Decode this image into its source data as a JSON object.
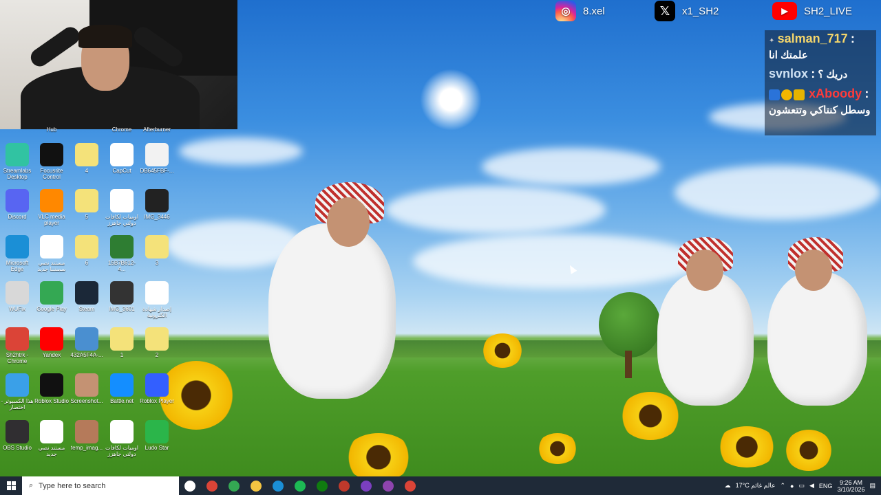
{
  "overlay": {
    "socials": [
      {
        "icon": "instagram-icon",
        "handle": "8.xel"
      },
      {
        "icon": "x-icon",
        "handle": "x1_SH2"
      },
      {
        "icon": "youtube-icon",
        "handle": "SH2_LIVE"
      }
    ],
    "chat": [
      {
        "user": "salman_717",
        "sep": ":",
        "message": "علمتك انا"
      },
      {
        "user": "svnlox",
        "sep": ":",
        "message": "دريك ؟"
      },
      {
        "user": "xAboody",
        "sep": ":",
        "message": "وسطل كنتاكي وتتعشون"
      }
    ]
  },
  "desktop": {
    "top_partial_labels": [
      "Hub",
      "Chrome",
      "Afterburner"
    ],
    "icons": [
      {
        "label": "Streamlabs Desktop",
        "icon": "streamlabs-icon",
        "color": "#31c3a2"
      },
      {
        "label": "Focusrite Control",
        "icon": "focusrite-icon",
        "color": "#111111"
      },
      {
        "label": "4",
        "icon": "music-file-icon",
        "color": "#f4e27a"
      },
      {
        "label": "CapCut",
        "icon": "capcut-icon",
        "color": "#ffffff"
      },
      {
        "label": "DB645FBF-...",
        "icon": "image-file-icon",
        "color": "#f2f2f2"
      },
      {
        "label": "Discord",
        "icon": "discord-icon",
        "color": "#5865f2"
      },
      {
        "label": "VLC media player",
        "icon": "vlc-icon",
        "color": "#ff8800"
      },
      {
        "label": "5",
        "icon": "folder-file-icon",
        "color": "#f4e27a"
      },
      {
        "label": "اوميات لكافات دولتي جاهزز",
        "icon": "document-icon",
        "color": "#ffffff"
      },
      {
        "label": "IMG_3446",
        "icon": "image-file-icon",
        "color": "#222222"
      },
      {
        "label": "Microsoft Edge",
        "icon": "edge-icon",
        "color": "#1b8fd6"
      },
      {
        "label": "مستند نصي سمننننا جديد",
        "icon": "text-document-icon",
        "color": "#ffffff"
      },
      {
        "label": "6",
        "icon": "folder-file-icon",
        "color": "#f4e27a"
      },
      {
        "label": "15B7B612-4...",
        "icon": "image-file-icon",
        "color": "#2e7d32"
      },
      {
        "label": "3",
        "icon": "music-file-icon",
        "color": "#f4e27a"
      },
      {
        "label": "WUFix",
        "icon": "wufix-icon",
        "color": "#d8d8d8"
      },
      {
        "label": "Google Play",
        "icon": "google-play-icon",
        "color": "#34a853"
      },
      {
        "label": "Steam",
        "icon": "steam-icon",
        "color": "#1b2838"
      },
      {
        "label": "IMG_3601",
        "icon": "image-file-icon",
        "color": "#333333"
      },
      {
        "label": "إصدار شهادة الكترونية",
        "icon": "document-icon",
        "color": "#ffffff"
      },
      {
        "label": "Sh2htrk - Chrome",
        "icon": "chrome-icon",
        "color": "#db4437"
      },
      {
        "label": "Yandex",
        "icon": "yandex-icon",
        "color": "#ff0000"
      },
      {
        "label": "432A5F4A-...",
        "icon": "image-file-icon",
        "color": "#4a8fd0"
      },
      {
        "label": "1",
        "icon": "folder-file-icon",
        "color": "#f4e27a"
      },
      {
        "label": "2",
        "icon": "folder-file-icon",
        "color": "#f4e27a"
      },
      {
        "label": "هذا الكمبيوتر - اختصار",
        "icon": "this-pc-icon",
        "color": "#3aa0e8"
      },
      {
        "label": "Roblox Studio",
        "icon": "roblox-studio-icon",
        "color": "#111111"
      },
      {
        "label": "Screenshot...",
        "icon": "image-file-icon",
        "color": "#c49273"
      },
      {
        "label": "Battle.net",
        "icon": "battlenet-icon",
        "color": "#148eff"
      },
      {
        "label": "Roblox Player",
        "icon": "roblox-player-icon",
        "color": "#335fff"
      },
      {
        "label": "OBS Studio",
        "icon": "obs-icon",
        "color": "#302e31"
      },
      {
        "label": "مستند نصي جديد",
        "icon": "text-document-icon",
        "color": "#ffffff"
      },
      {
        "label": "temp_imag...",
        "icon": "image-file-icon",
        "color": "#b57a5a"
      },
      {
        "label": "اوميات لكافات دولتي جاهزز",
        "icon": "document-icon",
        "color": "#ffffff"
      },
      {
        "label": "Ludo Star",
        "icon": "ludo-star-icon",
        "color": "#2bb54a"
      }
    ]
  },
  "taskbar": {
    "search_placeholder": "Type here to search",
    "apps": [
      {
        "icon": "task-view-icon",
        "color": "#ffffff"
      },
      {
        "icon": "chrome-icon",
        "color": "#db4437"
      },
      {
        "icon": "google-play-icon",
        "color": "#34a853"
      },
      {
        "icon": "file-explorer-icon",
        "color": "#f4c542"
      },
      {
        "icon": "edge-icon",
        "color": "#1b8fd6"
      },
      {
        "icon": "spotify-icon",
        "color": "#1db954"
      },
      {
        "icon": "xbox-icon",
        "color": "#107c10"
      },
      {
        "icon": "app-icon",
        "color": "#c0392b"
      },
      {
        "icon": "app-icon",
        "color": "#7b3fbf"
      },
      {
        "icon": "app-icon",
        "color": "#8e44ad"
      },
      {
        "icon": "chrome-icon",
        "color": "#db4437"
      }
    ],
    "weather": "17°C عالم غائم",
    "language": "ENG",
    "time": "9:26 AM",
    "date": "3/10/2026"
  }
}
